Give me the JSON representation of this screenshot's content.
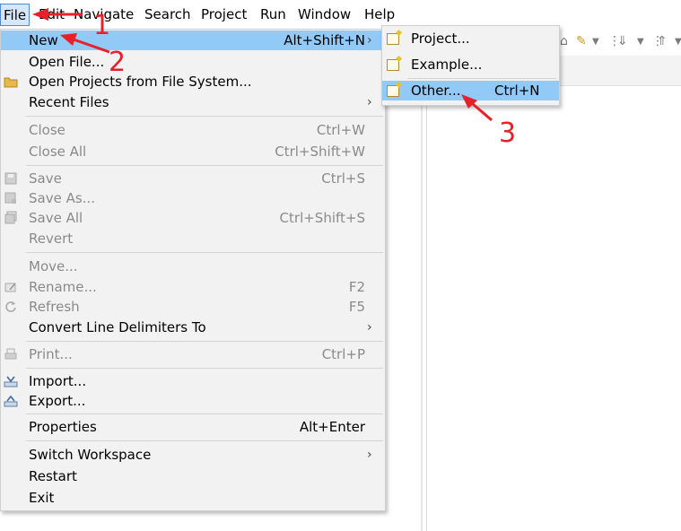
{
  "menubar": {
    "items": [
      "File",
      "Edit",
      "Navigate",
      "Search",
      "Project",
      "Run",
      "Window",
      "Help"
    ]
  },
  "file_menu": {
    "new": {
      "label": "New",
      "accel": "Alt+Shift+N"
    },
    "open_file": {
      "label": "Open File..."
    },
    "open_projects": {
      "label": "Open Projects from File System..."
    },
    "recent_files": {
      "label": "Recent Files"
    },
    "close": {
      "label": "Close",
      "accel": "Ctrl+W"
    },
    "close_all": {
      "label": "Close All",
      "accel": "Ctrl+Shift+W"
    },
    "save": {
      "label": "Save",
      "accel": "Ctrl+S"
    },
    "save_as": {
      "label": "Save As..."
    },
    "save_all": {
      "label": "Save All",
      "accel": "Ctrl+Shift+S"
    },
    "revert": {
      "label": "Revert"
    },
    "move": {
      "label": "Move..."
    },
    "rename": {
      "label": "Rename...",
      "accel": "F2"
    },
    "refresh": {
      "label": "Refresh",
      "accel": "F5"
    },
    "convert_line_delimiters": {
      "label": "Convert Line Delimiters To"
    },
    "print": {
      "label": "Print...",
      "accel": "Ctrl+P"
    },
    "import": {
      "label": "Import..."
    },
    "export": {
      "label": "Export..."
    },
    "properties": {
      "label": "Properties",
      "accel": "Alt+Enter"
    },
    "switch_workspace": {
      "label": "Switch Workspace"
    },
    "restart": {
      "label": "Restart"
    },
    "exit": {
      "label": "Exit"
    }
  },
  "new_submenu": {
    "project": {
      "label": "Project..."
    },
    "example": {
      "label": "Example..."
    },
    "other": {
      "label": "Other...",
      "accel": "Ctrl+N"
    }
  },
  "annotations": {
    "step1": "1",
    "step2": "2",
    "step3": "3"
  },
  "colors": {
    "highlight": "#91c9f7",
    "annotation": "#e8202a",
    "menu_bg": "#f2f2f2"
  },
  "icons": {
    "open_projects": "folder-icon",
    "save": "save-icon",
    "save_as": "save-as-icon",
    "save_all": "save-all-icon",
    "rename": "rename-icon",
    "refresh": "refresh-icon",
    "print": "print-icon",
    "import": "import-icon",
    "export": "export-icon",
    "submenu_items": "new-wizard-icon"
  }
}
